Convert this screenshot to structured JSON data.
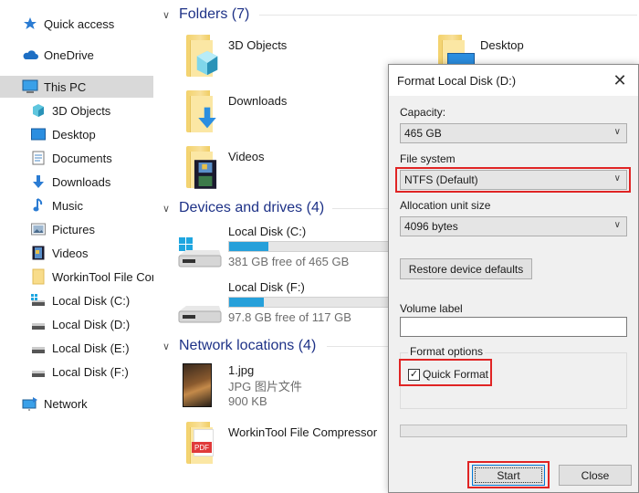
{
  "sidebar": {
    "items": [
      {
        "label": "Quick access",
        "icon": "star-icon"
      },
      {
        "label": "OneDrive",
        "icon": "cloud-icon"
      },
      {
        "label": "This PC",
        "icon": "computer-icon",
        "selected": true
      },
      {
        "label": "3D Objects",
        "icon": "cube-icon"
      },
      {
        "label": "Desktop",
        "icon": "desktop-icon"
      },
      {
        "label": "Documents",
        "icon": "document-icon"
      },
      {
        "label": "Downloads",
        "icon": "download-icon"
      },
      {
        "label": "Music",
        "icon": "music-icon"
      },
      {
        "label": "Pictures",
        "icon": "picture-icon"
      },
      {
        "label": "Videos",
        "icon": "video-icon"
      },
      {
        "label": "WorkinTool File Cor",
        "icon": "folder-icon"
      },
      {
        "label": "Local Disk (C:)",
        "icon": "system-drive-icon"
      },
      {
        "label": "Local Disk (D:)",
        "icon": "drive-icon"
      },
      {
        "label": "Local Disk (E:)",
        "icon": "drive-icon"
      },
      {
        "label": "Local Disk (F:)",
        "icon": "drive-icon"
      },
      {
        "label": "Network",
        "icon": "network-icon"
      }
    ]
  },
  "main": {
    "folders": {
      "title": "Folders (7)",
      "items": [
        {
          "name": "3D Objects"
        },
        {
          "name": "Desktop"
        },
        {
          "name": "Downloads"
        },
        {
          "name": "Videos"
        }
      ]
    },
    "drives": {
      "title": "Devices and drives (4)",
      "items": [
        {
          "name": "Local Disk (C:)",
          "free_text": "381 GB free of 465 GB",
          "used_fraction": 0.18
        },
        {
          "name": "Local Disk (F:)",
          "free_text": "97.8 GB free of 117 GB",
          "used_fraction": 0.16
        }
      ]
    },
    "network": {
      "title": "Network locations (4)",
      "items": [
        {
          "name": "1.jpg",
          "type": "JPG 图片文件",
          "size": "900 KB"
        },
        {
          "name": "WorkinTool File Compressor"
        }
      ]
    }
  },
  "dialog": {
    "title": "Format Local Disk (D:)",
    "capacity_label": "Capacity:",
    "capacity_value": "465 GB",
    "filesystem_label": "File system",
    "filesystem_value": "NTFS (Default)",
    "allocation_label": "Allocation unit size",
    "allocation_value": "4096 bytes",
    "restore_button": "Restore device defaults",
    "volume_label": "Volume label",
    "volume_value": "",
    "format_options_label": "Format options",
    "quick_format_label": "Quick Format",
    "quick_format_checked": true,
    "progress": 0,
    "start_button": "Start",
    "close_button": "Close"
  },
  "colors": {
    "accent": "#26a0da",
    "highlight": "#e02424",
    "section_title": "#1e3287"
  }
}
